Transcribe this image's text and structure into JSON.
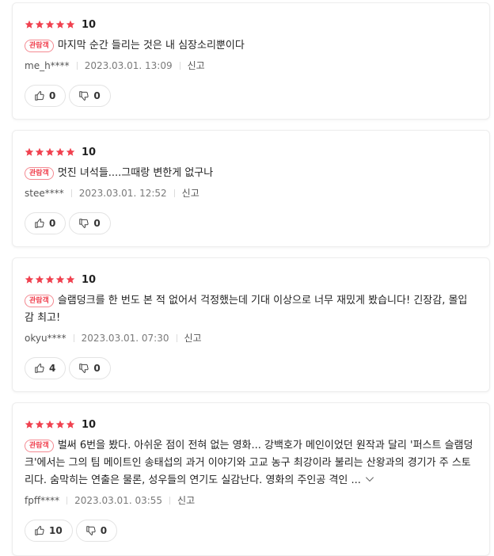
{
  "badge_label": "관람객",
  "colors": {
    "star": "#f0414f",
    "badge": "#f0414f"
  },
  "reviews": [
    {
      "score": "10",
      "text": "마지막 순간 들리는 것은 내 심장소리뿐이다",
      "author": "me_h****",
      "date": "2023.03.01. 13:09",
      "report": "신고",
      "likes": "0",
      "dislikes": "0"
    },
    {
      "score": "10",
      "text": "멋진 녀석들....그때랑 변한게 없구나",
      "author": "stee****",
      "date": "2023.03.01. 12:52",
      "report": "신고",
      "likes": "0",
      "dislikes": "0"
    },
    {
      "score": "10",
      "text": "슬램덩크를 한 번도 본 적 없어서 걱정했는데 기대 이상으로 너무 재밌게 봤습니다! 긴장감, 몰입감 최고!",
      "author": "okyu****",
      "date": "2023.03.01. 07:30",
      "report": "신고",
      "likes": "4",
      "dislikes": "0"
    },
    {
      "score": "10",
      "text": "벌써 6번을 봤다. 아쉬운 점이 전혀 없는 영화... 강백호가 메인이었던 원작과 달리 '퍼스트 슬램덩크'에서는 그의 팀 메이트인 송태섭의 과거 이야기와 고교 농구 최강이라 불리는 산왕과의 경기가 주 스토리다. 숨막히는 연출은 물론, 성우들의 연기도 실감난다. 영화의 주인공 격인 ...",
      "author": "fpff****",
      "date": "2023.03.01. 03:55",
      "report": "신고",
      "likes": "10",
      "dislikes": "0"
    }
  ]
}
